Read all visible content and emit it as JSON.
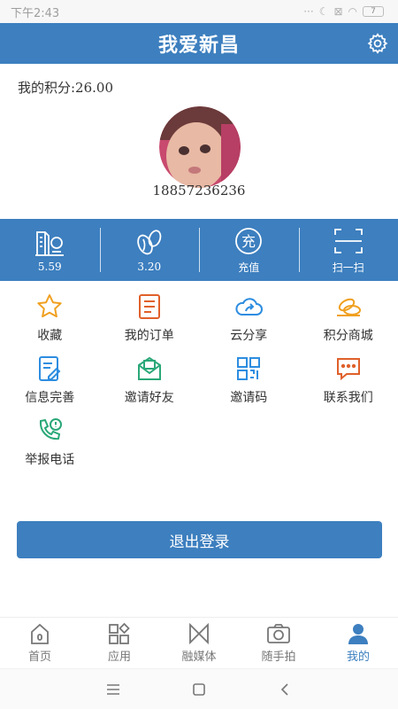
{
  "status_bar": {
    "time": "下午2:43",
    "battery": "7"
  },
  "header": {
    "title": "我爱新昌"
  },
  "profile": {
    "points_label": "我的积分:26.00",
    "phone": "18857236236"
  },
  "stats": [
    {
      "icon": "building-icon",
      "label": "5.59"
    },
    {
      "icon": "beans-icon",
      "label": "3.20"
    },
    {
      "icon": "recharge-icon",
      "icon_text": "充",
      "label": "充值"
    },
    {
      "icon": "scan-icon",
      "label": "扫一扫"
    }
  ],
  "grid": [
    {
      "icon": "star-icon",
      "label": "收藏",
      "color": "#f0a020"
    },
    {
      "icon": "order-icon",
      "label": "我的订单",
      "color": "#e0602a"
    },
    {
      "icon": "cloud-share-icon",
      "label": "云分享",
      "color": "#2d8de0"
    },
    {
      "icon": "coins-icon",
      "label": "积分商城",
      "color": "#f0a020"
    },
    {
      "icon": "edit-info-icon",
      "label": "信息完善",
      "color": "#2d8de0"
    },
    {
      "icon": "invite-mail-icon",
      "label": "邀请好友",
      "color": "#2aa878"
    },
    {
      "icon": "qr-code-icon",
      "label": "邀请码",
      "color": "#2d8de0"
    },
    {
      "icon": "chat-icon",
      "label": "联系我们",
      "color": "#e0602a"
    },
    {
      "icon": "report-phone-icon",
      "label": "举报电话",
      "color": "#2aa878"
    }
  ],
  "logout": {
    "label": "退出登录"
  },
  "tabs": [
    {
      "icon": "home-icon",
      "label": "首页"
    },
    {
      "icon": "apps-icon",
      "label": "应用"
    },
    {
      "icon": "media-icon",
      "label": "融媒体"
    },
    {
      "icon": "camera-icon",
      "label": "随手拍"
    },
    {
      "icon": "user-icon",
      "label": "我的",
      "active": true
    }
  ],
  "colors": {
    "primary": "#3d7fbf",
    "text": "#333333"
  }
}
